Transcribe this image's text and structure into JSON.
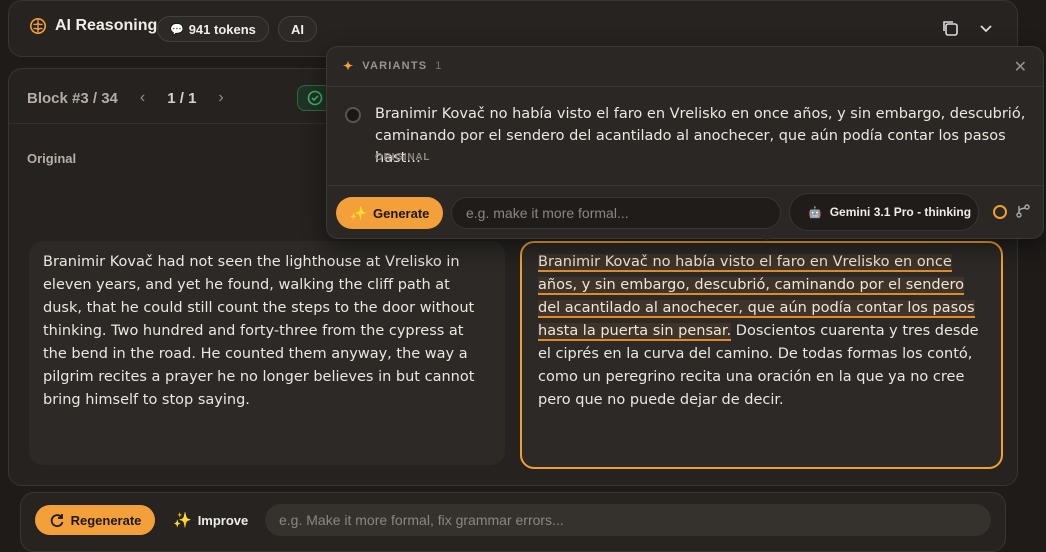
{
  "header": {
    "title": "AI Reasoning",
    "tokens_badge": "941 tokens",
    "ai_badge": "AI"
  },
  "block": {
    "label": "Block #3 / 34",
    "page": "1 / 1"
  },
  "original": {
    "label": "Original",
    "text": "Branimir Kovač had not seen the lighthouse at Vrelisko in eleven years, and yet he found, walking the cliff path at dusk, that he could still count the steps to the door without thinking. Two hundred and forty-three from the cypress at the bend in the road. He counted them anyway, the way a pilgrim recites a prayer he no longer believes in but cannot bring himself to stop saying."
  },
  "translation": {
    "highlighted": "Branimir Kovač no había visto el faro en Vrelisko en once años, y sin embargo, descubrió, caminando por el sendero del acantilado al anochecer, que aún podía contar los pasos hasta la puerta sin pensar.",
    "rest": " Doscientos cuarenta y tres desde el ciprés en la curva del camino. De todas formas los contó, como un peregrino recita una oración en la que ya no cree pero que no puede dejar de decir."
  },
  "variants": {
    "header": "VARIANTS",
    "count": "1",
    "item_text": "Branimir Kovač no había visto el faro en Vrelisko en once años, y sin embargo, descubrió, caminando por el sendero del acantilado al anochecer, que aún podía contar los pasos hast…",
    "item_tag": "ORIGINAL",
    "generate_label": "Generate",
    "input_placeholder": "e.g. make it more formal...",
    "model": "Gemini 3.1 Pro - thinking"
  },
  "bottom": {
    "regenerate_label": "Regenerate",
    "improve_label": "Improve",
    "input_placeholder": "e.g. Make it more formal, fix grammar errors..."
  },
  "colors": {
    "accent": "#f3a03a",
    "background": "#1e1b19",
    "panel": "#262320",
    "success": "#3fb35f"
  },
  "icons": [
    "brain-icon",
    "chat-icon",
    "copy-icon",
    "chevron-down-icon",
    "chevron-left-icon",
    "chevron-right-icon",
    "check-circle-icon",
    "sparkle-icon",
    "close-icon",
    "refresh-icon",
    "branch-icon",
    "spinner-icon"
  ]
}
